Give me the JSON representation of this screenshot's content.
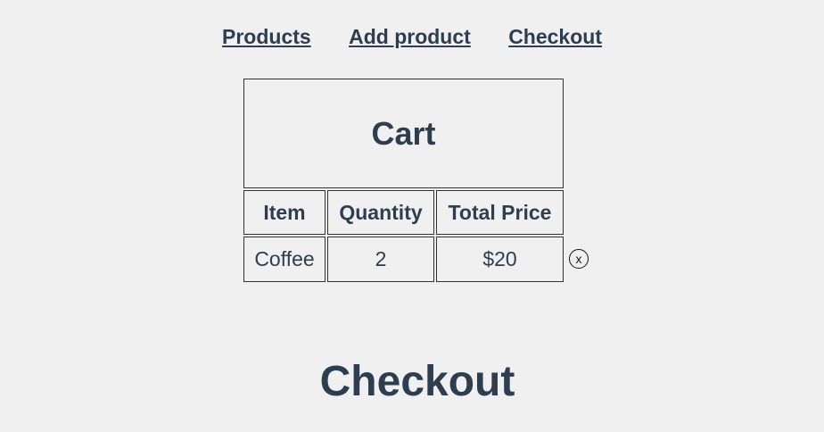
{
  "nav": {
    "items": [
      {
        "label": "Products"
      },
      {
        "label": "Add product"
      },
      {
        "label": "Checkout"
      }
    ]
  },
  "cart": {
    "title": "Cart",
    "columns": [
      "Item",
      "Quantity",
      "Total Price"
    ],
    "rows": [
      {
        "item": "Coffee",
        "quantity": "2",
        "total_price": "$20",
        "remove_label": "x"
      }
    ]
  },
  "checkout": {
    "title": "Checkout"
  }
}
